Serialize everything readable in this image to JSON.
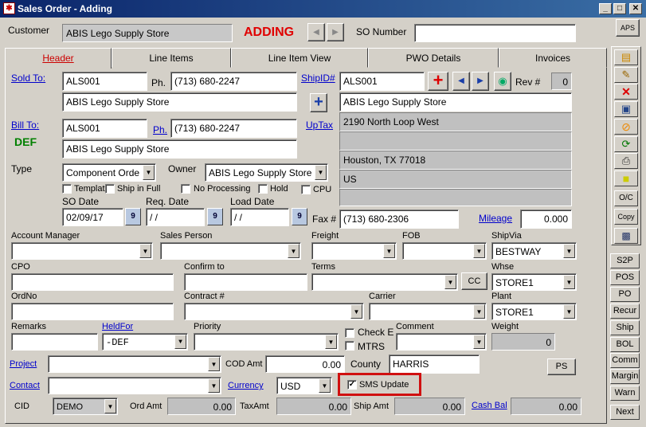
{
  "window": {
    "title": "Sales Order - Adding",
    "icon": "app-icon"
  },
  "header": {
    "customer_label": "Customer",
    "customer_value": "ABIS Lego Supply Store",
    "mode": "ADDING",
    "so_number_label": "SO Number",
    "so_number_value": "",
    "aps": "APS"
  },
  "tabs": [
    "Header",
    "Line Items",
    "Line Item View",
    "PWO Details",
    "Invoices"
  ],
  "sold_to": {
    "label": "Sold To:",
    "code": "ALS001",
    "ph_label": "Ph.",
    "phone": "(713) 680-2247",
    "name": "ABIS Lego Supply Store"
  },
  "bill_to": {
    "label": "Bill To:",
    "code": "ALS001",
    "ph_label": "Ph.",
    "phone": "(713) 680-2247",
    "name": "ABIS Lego Supply Store",
    "def": "DEF"
  },
  "ship": {
    "label": "ShipID#",
    "code": "ALS001",
    "rev_label": "Rev #",
    "rev": "0",
    "uptax": "UpTax",
    "lines": [
      "ABIS Lego Supply Store",
      "2190 North Loop West",
      "",
      "Houston, TX 77018",
      "US",
      ""
    ]
  },
  "type": {
    "label": "Type",
    "value": "Component Orde",
    "owner_label": "Owner",
    "owner_value": "ABIS Lego Supply Store"
  },
  "checks": {
    "template": "Template",
    "ship_in_full": "Ship in Full",
    "no_processing": "No Processing",
    "hold": "Hold",
    "cpu": "CPU"
  },
  "dates": {
    "so_label": "SO Date",
    "so_value": "02/09/17",
    "req_label": "Req. Date",
    "req_value": "/ /",
    "load_label": "Load Date",
    "load_value": "/ /",
    "cal_glyph": "9"
  },
  "fax": {
    "label": "Fax #",
    "value": "(713) 680-2306",
    "mileage_label": "Mileage",
    "mileage_value": "0.000"
  },
  "row1": {
    "acct_mgr": "Account Manager",
    "sales_person": "Sales Person",
    "freight": "Freight",
    "fob": "FOB",
    "shipvia": "ShipVia",
    "shipvia_value": "BESTWAY"
  },
  "row2": {
    "cpo": "CPO",
    "confirm_to": "Confirm to",
    "terms": "Terms",
    "cc": "CC",
    "whse": "Whse",
    "whse_value": "STORE1"
  },
  "row3": {
    "ordno": "OrdNo",
    "contract": "Contract #",
    "carrier": "Carrier",
    "plant": "Plant",
    "plant_value": "STORE1"
  },
  "row4": {
    "remarks": "Remarks",
    "heldfor": "HeldFor",
    "heldfor_value": "-DEF",
    "priority": "Priority",
    "check_e": "Check E",
    "mtrs": "MTRS",
    "comment": "Comment",
    "weight": "Weight",
    "weight_value": "0"
  },
  "row5": {
    "project": "Project",
    "cod_amt": "COD Amt",
    "cod_value": "0.00",
    "county": "County",
    "county_value": "HARRIS",
    "ps": "PS"
  },
  "row6": {
    "contact": "Contact",
    "currency": "Currency",
    "currency_value": "USD",
    "sms": "SMS Update"
  },
  "row7": {
    "cid": "CID",
    "cid_value": "DEMO",
    "ord_amt": "Ord Amt",
    "ord_value": "0.00",
    "tax_amt": "TaxAmt",
    "tax_value": "0.00",
    "ship_amt": "Ship Amt",
    "ship_value": "0.00",
    "cash_bal": "Cash Bal",
    "cash_value": "0.00"
  },
  "side_tools": [
    "new-doc-icon",
    "edit-icon",
    "delete-icon",
    "save-icon",
    "cancel-icon",
    "refresh-icon",
    "print-icon",
    "note-icon"
  ],
  "side_labels": {
    "oc": "O/C",
    "copy": "Copy"
  },
  "right_buttons": [
    "S2P",
    "POS",
    "PO",
    "Recur",
    "Ship",
    "BOL",
    "Comm",
    "Margin",
    "Warn",
    "Next"
  ],
  "colors": {
    "adding_red": "#e00000",
    "title_blue": "#0a246a",
    "link_blue": "#0000cc",
    "def_green": "#008000",
    "highlight_red": "#d01010"
  }
}
